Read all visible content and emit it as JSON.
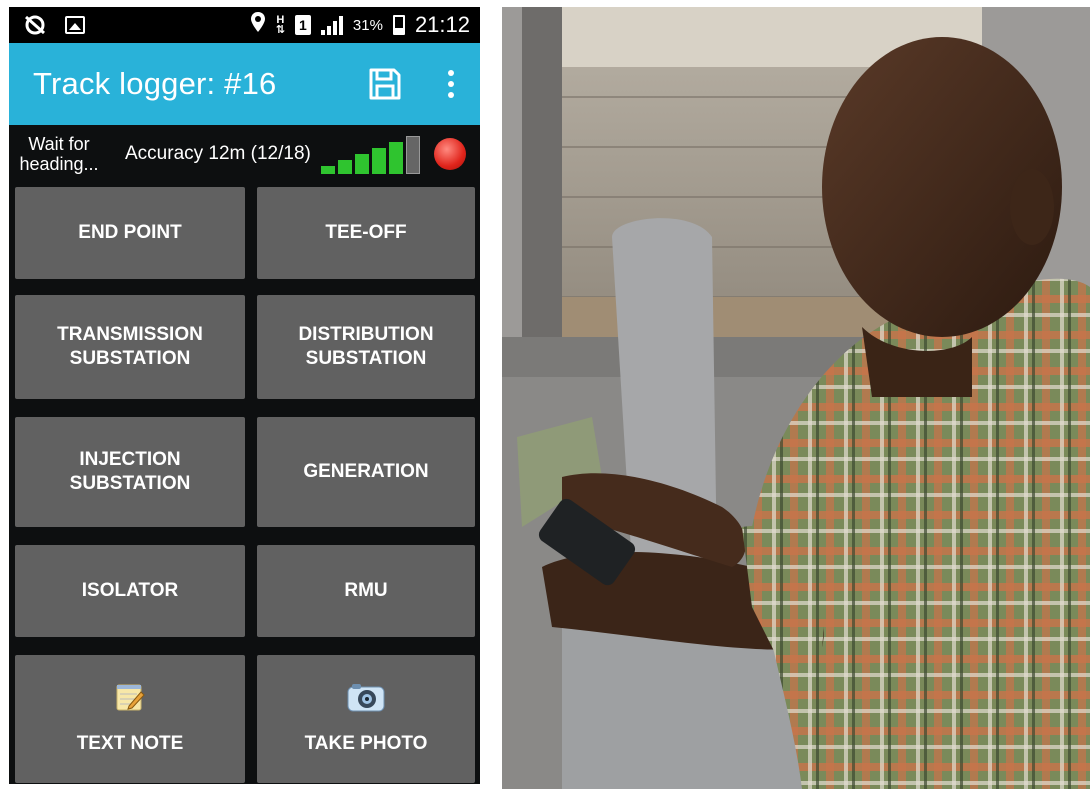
{
  "status_bar": {
    "signal_type": "H",
    "sim_label": "1",
    "battery_percent": "31%",
    "battery_fraction": 0.31,
    "time": "21:12"
  },
  "app_bar": {
    "title": "Track logger: #16",
    "save_icon": "save-icon",
    "overflow_icon": "more-vert-icon",
    "color": "#29b2d9"
  },
  "info_bar": {
    "wait_status": "Wait for heading...",
    "accuracy": "Accuracy 12m (12/18)",
    "signal_level_filled": 5,
    "signal_level_total": 6,
    "recording_color": "#e0241b"
  },
  "buttons": [
    {
      "label": "END POINT"
    },
    {
      "label": "TEE-OFF"
    },
    {
      "label": "TRANSMISSION SUBSTATION"
    },
    {
      "label": "DISTRIBUTION SUBSTATION"
    },
    {
      "label": "INJECTION SUBSTATION"
    },
    {
      "label": "GENERATION"
    },
    {
      "label": "ISOLATOR"
    },
    {
      "label": "RMU"
    },
    {
      "label": "TEXT NOTE",
      "icon": "notepad-icon"
    },
    {
      "label": "TAKE PHOTO",
      "icon": "camera-icon"
    }
  ],
  "colors": {
    "button_bg": "#616161",
    "screen_bg": "#0d0f10",
    "signal_green": "#2fc42f"
  }
}
